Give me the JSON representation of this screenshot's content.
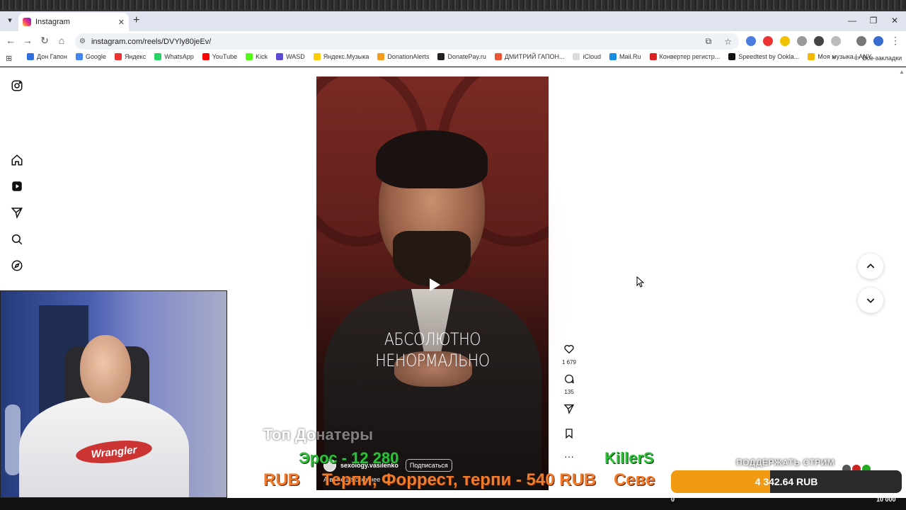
{
  "browser": {
    "tab_title": "Instagram",
    "url": "instagram.com/reels/DVYly80jeEv/",
    "bookmarks": [
      {
        "label": "Дон Гапон",
        "color": "#2f6fe0"
      },
      {
        "label": "Google",
        "color": "#4285f4"
      },
      {
        "label": "Яндекс",
        "color": "#e33"
      },
      {
        "label": "WhatsApp",
        "color": "#25d366"
      },
      {
        "label": "YouTube",
        "color": "#f00"
      },
      {
        "label": "Kick",
        "color": "#53fc18"
      },
      {
        "label": "WASD",
        "color": "#5b4bd6"
      },
      {
        "label": "Яндекс.Музыка",
        "color": "#ffcc00"
      },
      {
        "label": "DonationAlerts",
        "color": "#f59c1a"
      },
      {
        "label": "DonatePay.ru",
        "color": "#222"
      },
      {
        "label": "ДМИТРИЙ ГАПОН...",
        "color": "#e53"
      },
      {
        "label": "iCloud",
        "color": "#ddd"
      },
      {
        "label": "Mail.Ru",
        "color": "#168de2"
      },
      {
        "label": "Конвертер регистр...",
        "color": "#d22"
      },
      {
        "label": "Speedtest by Ookla...",
        "color": "#111"
      },
      {
        "label": "Моя музыка | ANY...",
        "color": "#f5b800"
      }
    ],
    "all_bookmarks": "Все закладки"
  },
  "reel": {
    "caption_line1": "АБСОЛЮТНО",
    "caption_line2": "НЕНОРМАЛЬНО",
    "username": "sexology.vasilenko",
    "follow_label": "Подписаться",
    "description": "А вот ещё сложнее … ",
    "likes": "1 679",
    "comments": "135"
  },
  "overlay": {
    "title": "Топ Донатеры",
    "green_line_1": "Эрос - 12 280",
    "green_line_2": "KillerS",
    "orange_left": "RUB",
    "orange_mid": "Терпи, Форрест, терпи - 540 RUB",
    "orange_right": "Севе",
    "support_label": "ПОДДЕРЖАТЬ СТРИМ",
    "support_amount": "4 342.64 RUB",
    "goal_min": "0",
    "goal_max": "10 000",
    "goal_progress": 0.43
  },
  "webcam": {
    "shirt_logo": "Wrangler"
  },
  "colors": {
    "accent_orange": "#f29a12",
    "ticker_green": "#2fbf3a",
    "ticker_orange": "#f07b2a"
  }
}
